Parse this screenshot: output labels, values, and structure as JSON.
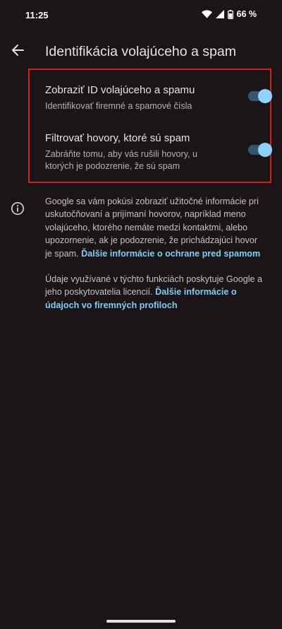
{
  "status_bar": {
    "time": "11:25",
    "battery": "66 %"
  },
  "header": {
    "title": "Identifikácia volajúceho a spam"
  },
  "settings": [
    {
      "title": "Zobraziť ID volajúceho a spamu",
      "subtitle": "Identifikovať firemné a spamové čísla",
      "enabled": true
    },
    {
      "title": "Filtrovať hovory, ktoré sú spam",
      "subtitle": "Zabráňte tomu, aby vás rušili hovory, u ktorých je podozrenie, že sú spam",
      "enabled": true
    }
  ],
  "info": {
    "paragraph1": "Google sa vám pokúsi zobraziť užitočné informácie pri uskutočňovaní a prijímaní hovorov, napríklad meno volajúceho, ktorého nemáte medzi kontaktmi, alebo upozornenie, ak je podozrenie, že prichádzajúci hovor je spam.",
    "link1": "Ďalšie informácie o ochrane pred spamom",
    "paragraph2": "Údaje využívané v týchto funkciách poskytuje Google a jeho poskytovatelia licencií.",
    "link2": "Ďalšie informácie o údajoch vo firemných profiloch"
  },
  "colors": {
    "background": "#1c1517",
    "accent": "#8fd1ff",
    "link": "#7fcdf5",
    "highlight": "#d3201f"
  },
  "icons": [
    "wifi-icon",
    "signal-icon",
    "battery-icon",
    "back-arrow-icon",
    "info-icon"
  ]
}
